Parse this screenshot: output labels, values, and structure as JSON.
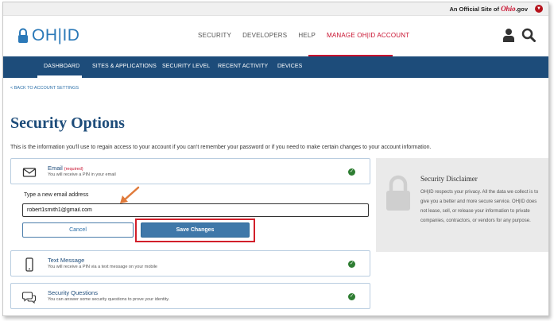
{
  "official_bar": {
    "prefix": "An Official Site of ",
    "ohio_word": "Ohio",
    "suffix": ".gov"
  },
  "header": {
    "logo_text": "OH|ID",
    "nav": [
      "SECURITY",
      "DEVELOPERS",
      "HELP",
      "MANAGE OH|ID ACCOUNT"
    ],
    "active_nav": "MANAGE OH|ID ACCOUNT",
    "icons": [
      "user-icon",
      "search-icon"
    ]
  },
  "subnav": {
    "items": [
      "DASHBOARD",
      "SITES & APPLICATIONS",
      "SECURITY LEVEL",
      "RECENT ACTIVITY",
      "DEVICES"
    ],
    "active": "DASHBOARD"
  },
  "back_link": "< BACK TO ACCOUNT SETTINGS",
  "page_title": "Security Options",
  "intro": "This is the information you'll use to regain access to your account if you can't remember your password or if you need to make certain changes to your account information.",
  "email": {
    "title": "Email",
    "required": "(required)",
    "desc": "You will receive a PIN in your email",
    "field_label": "Type a new email address",
    "field_value": "robert1smith1@gmail.com",
    "cancel_label": "Cancel",
    "save_label": "Save Changes"
  },
  "text_message": {
    "title": "Text Message",
    "desc": "You will receive a PIN via a text message on your mobile"
  },
  "security_questions": {
    "title": "Security Questions",
    "desc": "You can answer some security questions to prove your identity."
  },
  "disclaimer": {
    "title": "Security Disclaimer",
    "body": "OH|ID respects your privacy. All the data we collect is to give you a better and more secure service. OH|ID does not lease, sell, or release your information to private companies, contractors, or vendors for any purpose."
  },
  "colors": {
    "brand_blue": "#2b79b8",
    "nav_bg": "#1d4c7a",
    "accent_red": "#c8102e",
    "check_green": "#2e7d32"
  }
}
